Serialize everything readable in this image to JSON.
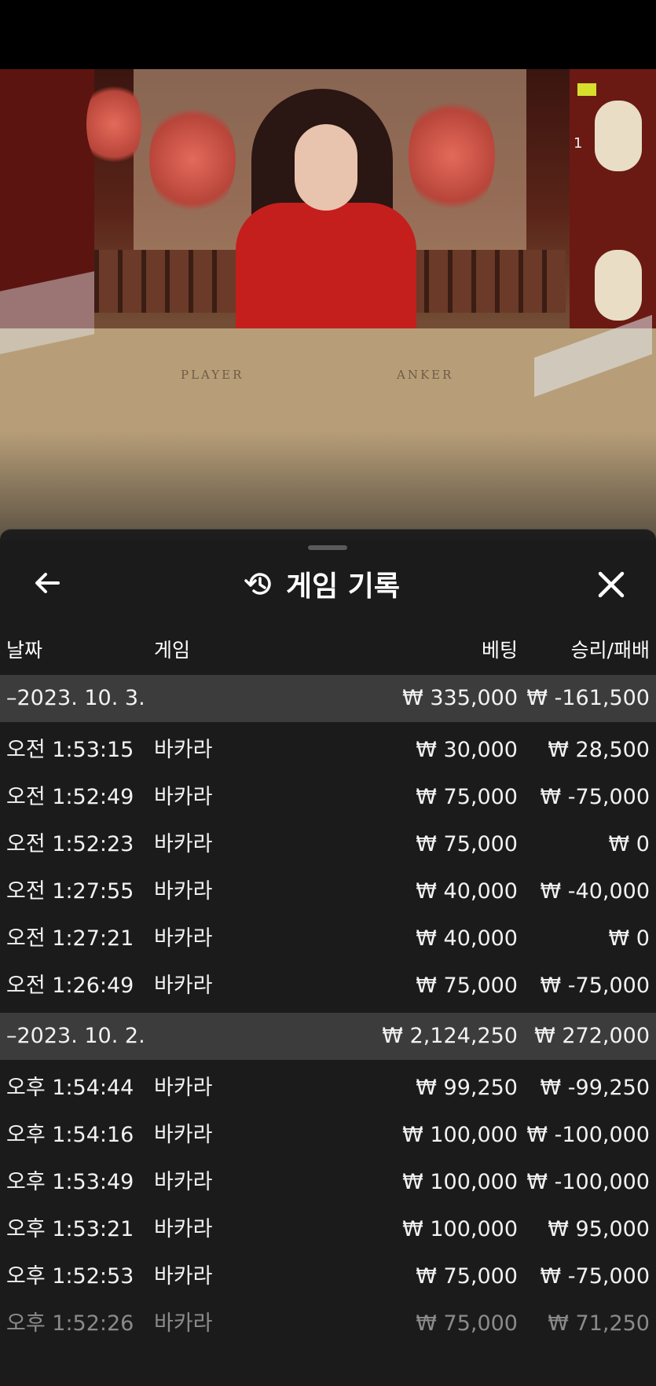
{
  "video": {
    "camera_label": "1",
    "table_labels": {
      "player": "PLAYER",
      "banker": "ANKER"
    }
  },
  "panel": {
    "title": "게임 기록",
    "back_icon": "arrow-left-icon",
    "history_icon": "history-icon",
    "close_icon": "close-icon",
    "columns": {
      "date": "날짜",
      "game": "게임",
      "bet": "베팅",
      "win_loss": "승리/패배"
    }
  },
  "groups": [
    {
      "date": "–2023. 10. 3.",
      "total_bet": "₩ 335,000",
      "total_win": "₩ -161,500",
      "rows": [
        {
          "time": "오전 1:53:15",
          "game": "바카라",
          "bet": "₩ 30,000",
          "win": "₩ 28,500"
        },
        {
          "time": "오전 1:52:49",
          "game": "바카라",
          "bet": "₩ 75,000",
          "win": "₩ -75,000"
        },
        {
          "time": "오전 1:52:23",
          "game": "바카라",
          "bet": "₩ 75,000",
          "win": "₩ 0"
        },
        {
          "time": "오전 1:27:55",
          "game": "바카라",
          "bet": "₩ 40,000",
          "win": "₩ -40,000"
        },
        {
          "time": "오전 1:27:21",
          "game": "바카라",
          "bet": "₩ 40,000",
          "win": "₩ 0"
        },
        {
          "time": "오전 1:26:49",
          "game": "바카라",
          "bet": "₩ 75,000",
          "win": "₩ -75,000"
        }
      ]
    },
    {
      "date": "–2023. 10. 2.",
      "total_bet": "₩ 2,124,250",
      "total_win": "₩ 272,000",
      "rows": [
        {
          "time": "오후 1:54:44",
          "game": "바카라",
          "bet": "₩ 99,250",
          "win": "₩ -99,250"
        },
        {
          "time": "오후 1:54:16",
          "game": "바카라",
          "bet": "₩ 100,000",
          "win": "₩ -100,000"
        },
        {
          "time": "오후 1:53:49",
          "game": "바카라",
          "bet": "₩ 100,000",
          "win": "₩ -100,000"
        },
        {
          "time": "오후 1:53:21",
          "game": "바카라",
          "bet": "₩ 100,000",
          "win": "₩ 95,000"
        },
        {
          "time": "오후 1:52:53",
          "game": "바카라",
          "bet": "₩ 75,000",
          "win": "₩ -75,000"
        },
        {
          "time": "오후 1:52:26",
          "game": "바카라",
          "bet": "₩ 75,000",
          "win": "₩ 71,250"
        }
      ]
    }
  ]
}
